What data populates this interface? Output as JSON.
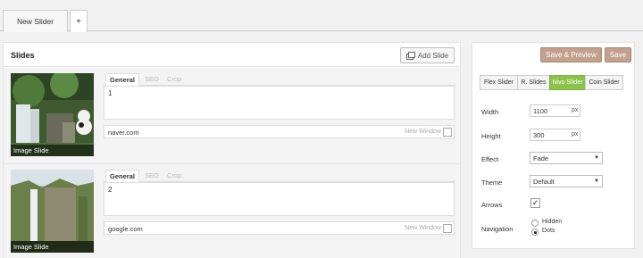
{
  "tabs": {
    "active": "New Slider",
    "add": "+"
  },
  "slides": {
    "title": "Slides",
    "add_button": "Add Slide",
    "items": [
      {
        "thumb_label": "Image Slide",
        "tabs": [
          "General",
          "SEO",
          "Crop"
        ],
        "text": "1",
        "link": "naver.com",
        "new_window": "New Window"
      },
      {
        "thumb_label": "Image Slide",
        "tabs": [
          "General",
          "SEO",
          "Crop"
        ],
        "text": "2",
        "link": "google.com",
        "new_window": "New Window"
      }
    ]
  },
  "settings": {
    "save_preview": "Save & Preview",
    "save": "Save",
    "types": [
      "Flex Slider",
      "R. Slides",
      "Nivo Slider",
      "Coin Slider"
    ],
    "active_type": "Nivo Slider",
    "width_label": "Width",
    "width_value": "1100",
    "width_unit": "px",
    "height_label": "Height",
    "height_value": "300",
    "height_unit": "px",
    "effect_label": "Effect",
    "effect_value": "Fade",
    "theme_label": "Theme",
    "theme_value": "Default",
    "arrows_label": "Arrows",
    "arrows_checked": "✓",
    "navigation_label": "Navigation",
    "nav_options": [
      "Hidden",
      "Dots"
    ],
    "nav_selected": "Dots"
  },
  "colors": {
    "accent_green": "#8bc34a",
    "save_brown": "#c3a28d"
  }
}
